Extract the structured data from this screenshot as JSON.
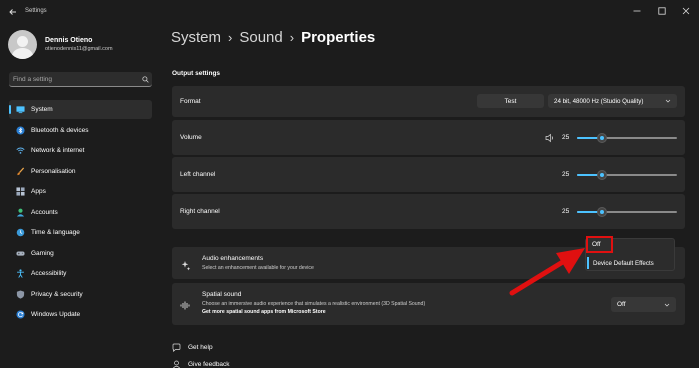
{
  "window": {
    "title": "Settings"
  },
  "profile": {
    "name": "Dennis Otieno",
    "email": "otienodennis11@gmail.com"
  },
  "search": {
    "placeholder": "Find a setting"
  },
  "nav": {
    "items": [
      {
        "label": "System",
        "icon": "monitor-icon",
        "active": true
      },
      {
        "label": "Bluetooth & devices",
        "icon": "bluetooth-icon"
      },
      {
        "label": "Network & internet",
        "icon": "wifi-icon"
      },
      {
        "label": "Personalisation",
        "icon": "brush-icon"
      },
      {
        "label": "Apps",
        "icon": "apps-icon"
      },
      {
        "label": "Accounts",
        "icon": "person-icon"
      },
      {
        "label": "Time & language",
        "icon": "globe-clock-icon"
      },
      {
        "label": "Gaming",
        "icon": "gamepad-icon"
      },
      {
        "label": "Accessibility",
        "icon": "accessibility-icon"
      },
      {
        "label": "Privacy & security",
        "icon": "shield-icon"
      },
      {
        "label": "Windows Update",
        "icon": "update-icon"
      }
    ]
  },
  "breadcrumb": {
    "level1": "System",
    "level2": "Sound",
    "current": "Properties",
    "separator": "›"
  },
  "output": {
    "section_title": "Output settings",
    "format": {
      "label": "Format",
      "test_button": "Test",
      "value": "24 bit, 48000 Hz (Studio Quality)"
    },
    "volume": {
      "label": "Volume",
      "value": "25",
      "level": 0.25
    },
    "left_channel": {
      "label": "Left channel",
      "value": "25",
      "level": 0.25
    },
    "right_channel": {
      "label": "Right channel",
      "value": "25",
      "level": 0.25
    }
  },
  "enhancements": {
    "title": "Audio enhancements",
    "description": "Select an enhancement available for your device",
    "options": [
      "Off",
      "Device Default Effects"
    ]
  },
  "spatial": {
    "title": "Spatial sound",
    "description": "Choose an immersive audio experience that simulates a realistic environment (3D Spatial Sound)",
    "link": "Get more spatial sound apps from Microsoft Store",
    "value": "Off"
  },
  "footer": {
    "help": "Get help",
    "feedback": "Give feedback"
  },
  "colors": {
    "accent": "#4cc2ff",
    "highlight": "#e01010",
    "background": "#1c1c1c",
    "card": "#2b2b2b"
  }
}
